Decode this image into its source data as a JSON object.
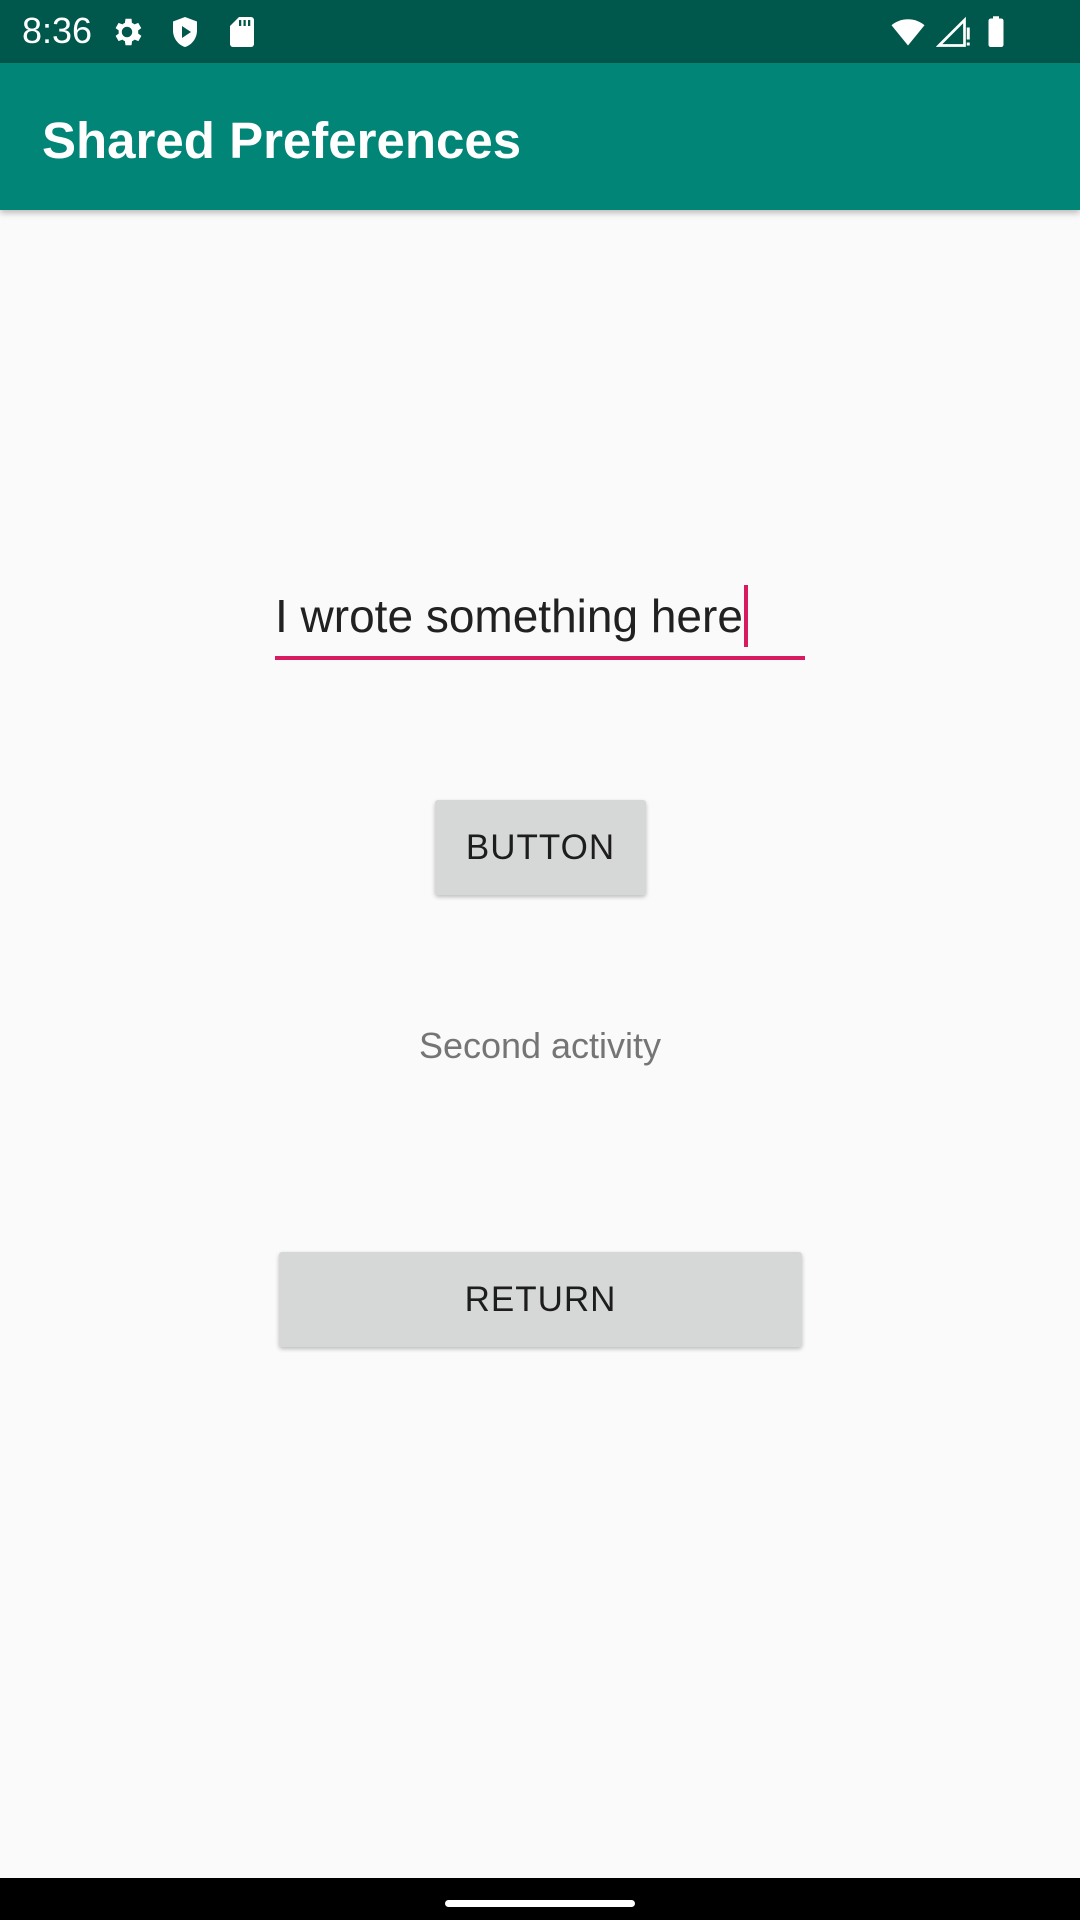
{
  "status_bar": {
    "time": "8:36",
    "icons": [
      "settings-icon",
      "play-protect-icon",
      "sd-card-icon",
      "wifi-icon",
      "signal-icon",
      "battery-icon"
    ],
    "background_color": "#00574b"
  },
  "app_bar": {
    "title": "Shared Preferences",
    "background_color": "#008577"
  },
  "main": {
    "edit_text": {
      "value": "I wrote something here",
      "accent_color": "#d81b60"
    },
    "button_label": "BUTTON",
    "second_activity_label": "Second activity",
    "return_label": "RETURN"
  }
}
